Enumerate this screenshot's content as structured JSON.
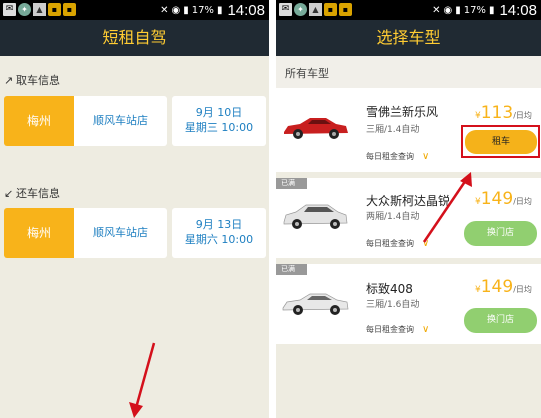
{
  "status_bar": {
    "left_icons": [
      "mail-icon",
      "app-icon",
      "picture-icon",
      "notification-icon",
      "notification-icon"
    ],
    "battery": "17%",
    "time": "14:08"
  },
  "left_screen": {
    "title": "短租自驾",
    "pickup": {
      "label": "取车信息",
      "city": "梅州",
      "store": "顺风车站店",
      "date_line1": "9月  10日",
      "date_line2": "星期三 10:00"
    },
    "return": {
      "label": "还车信息",
      "city": "梅州",
      "store": "顺风车站店",
      "date_line1": "9月  13日",
      "date_line2": "星期六 10:00"
    }
  },
  "right_screen": {
    "title": "选择车型",
    "subheader": "所有车型",
    "cars": [
      {
        "name": "雪佛兰新乐风",
        "spec": "三厢/1.4自动",
        "query": "每日租金查询",
        "currency": "¥",
        "price": "113",
        "unit": "/日均",
        "button": "租车",
        "tag": "",
        "color": "#c81f1f"
      },
      {
        "name": "大众斯柯达晶锐",
        "spec": "两厢/1.4自动",
        "query": "每日租金查询",
        "currency": "¥",
        "price": "149",
        "unit": "/日均",
        "button": "换门店",
        "tag": "已满",
        "color": "#d9d9d9"
      },
      {
        "name": "标致408",
        "spec": "三厢/1.6自动",
        "query": "每日租金查询",
        "currency": "¥",
        "price": "149",
        "unit": "/日均",
        "button": "换门店",
        "tag": "已满",
        "color": "#d9d9d9"
      }
    ]
  },
  "colors": {
    "app_bar": "#202a33",
    "title_text": "#ffcc33",
    "accent_orange": "#f8b31a",
    "link_blue": "#1e7fc1",
    "green_button": "#91cf70",
    "annotation_red": "#d4101b"
  }
}
